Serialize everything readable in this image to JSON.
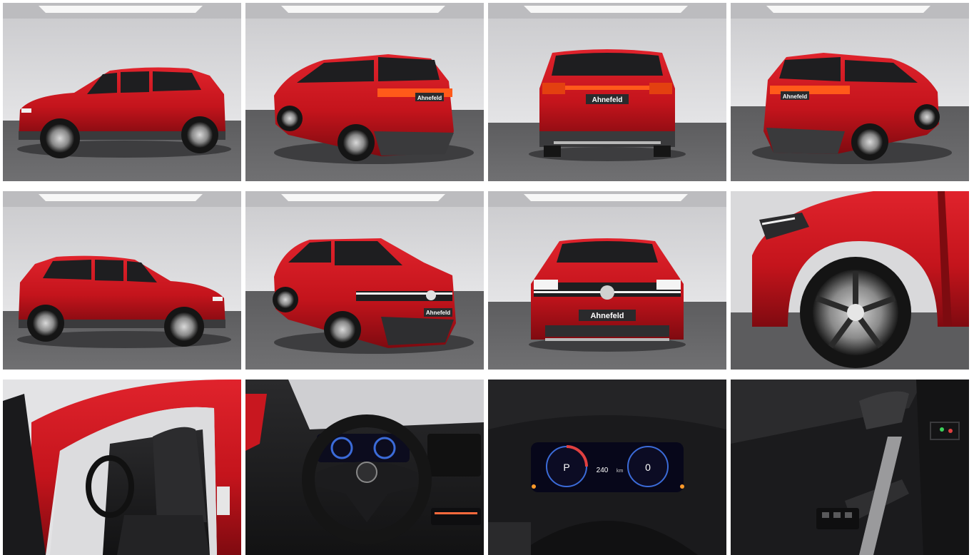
{
  "gallery": {
    "brand_plate": "Ahnefeld",
    "cluster": {
      "gear": "P",
      "speed": "240",
      "range_unit": "km",
      "right_value": "0"
    },
    "photos": [
      {
        "id": "side-left"
      },
      {
        "id": "rear-three-quarter-left"
      },
      {
        "id": "rear"
      },
      {
        "id": "rear-three-quarter-right"
      },
      {
        "id": "side-right"
      },
      {
        "id": "front-three-quarter-left"
      },
      {
        "id": "front"
      },
      {
        "id": "wheel-detail"
      },
      {
        "id": "driver-seat"
      },
      {
        "id": "steering-wheel"
      },
      {
        "id": "instrument-cluster"
      },
      {
        "id": "door-panel"
      }
    ]
  },
  "colors": {
    "car_red": "#c8171f",
    "car_red_dark": "#7d0b10",
    "studio_wall": "#d6d6d8",
    "studio_floor": "#616163",
    "interior": "#1e1e20"
  }
}
